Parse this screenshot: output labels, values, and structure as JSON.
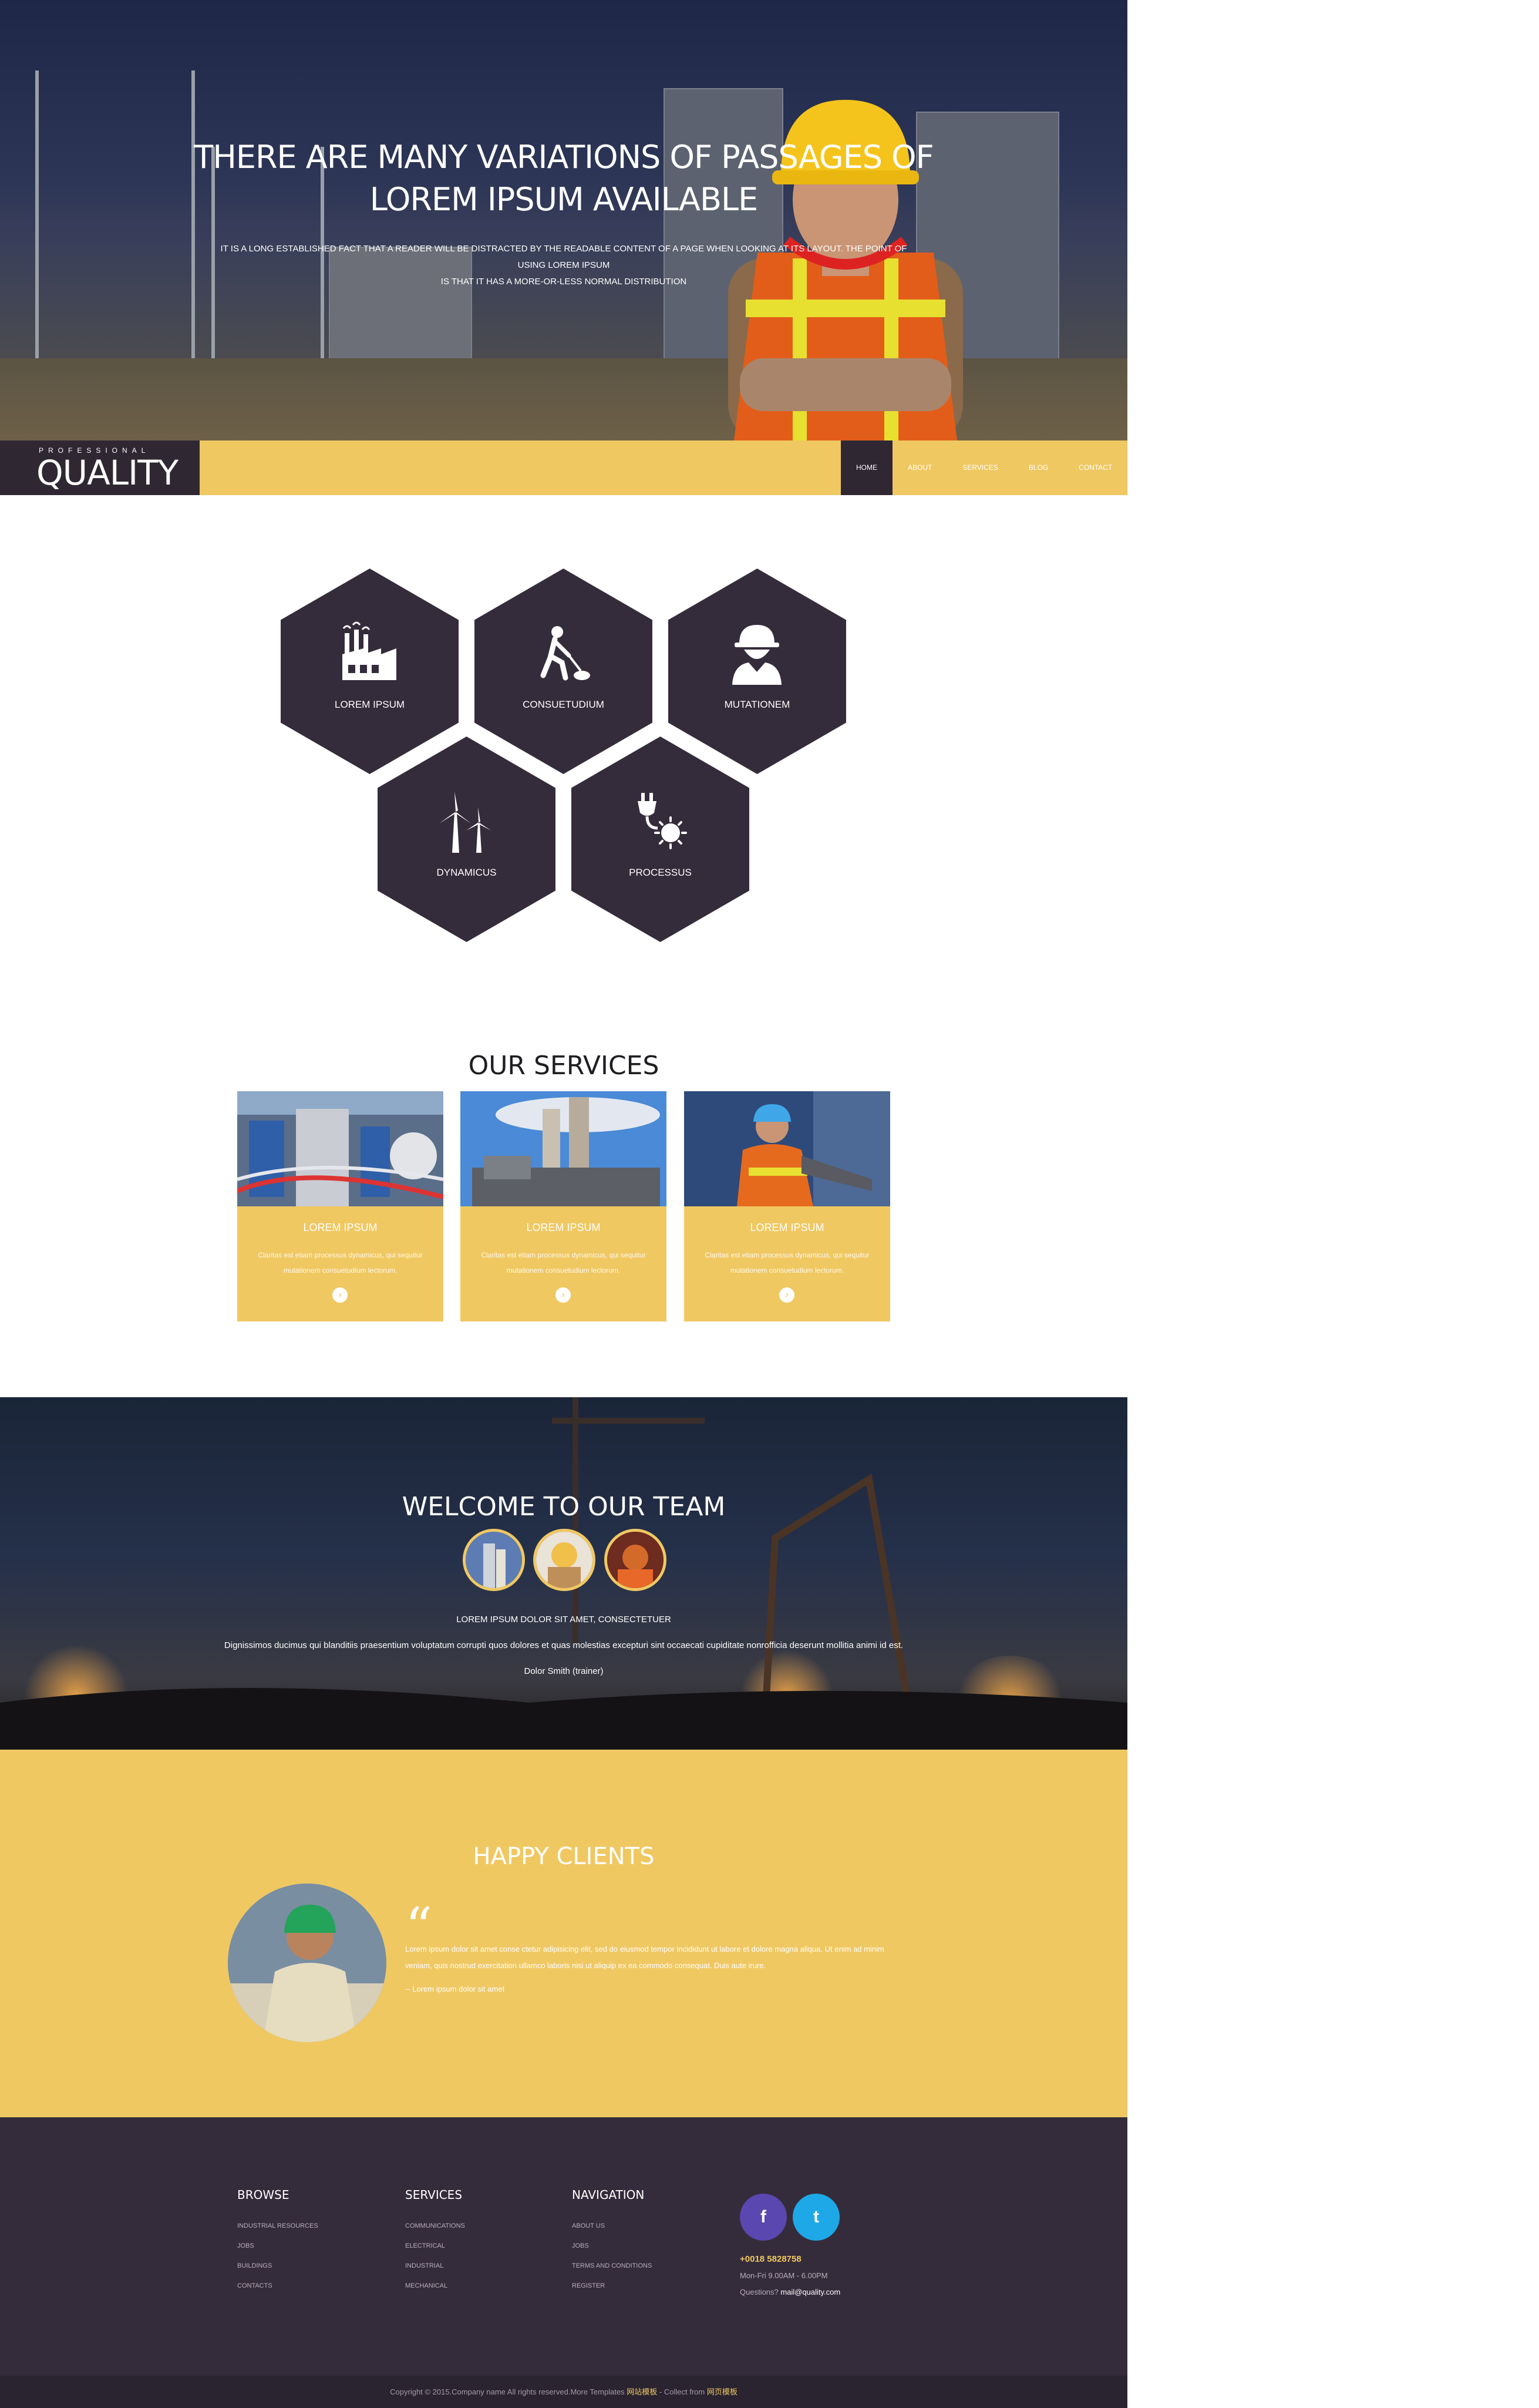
{
  "hero": {
    "title_line1": "THERE ARE MANY VARIATIONS OF PASSAGES OF",
    "title_line2": "LOREM IPSUM AVAILABLE",
    "subtitle_line1": "IT IS A LONG ESTABLISHED FACT THAT A READER WILL BE DISTRACTED BY THE READABLE CONTENT OF A PAGE WHEN LOOKING AT ITS LAYOUT. THE POINT OF USING LOREM IPSUM",
    "subtitle_line2": "IS THAT IT HAS A MORE-OR-LESS NORMAL DISTRIBUTION"
  },
  "logo": {
    "small": "PROFESSIONAL",
    "big": "QUALITY"
  },
  "nav": {
    "items": [
      "HOME",
      "ABOUT",
      "SERVICES",
      "BLOG",
      "CONTACT"
    ],
    "active": "HOME"
  },
  "features": [
    {
      "label": "LOREM IPSUM",
      "icon": "factory-icon"
    },
    {
      "label": "CONSUETUDIUM",
      "icon": "digging-worker-icon"
    },
    {
      "label": "MUTATIONEM",
      "icon": "worker-helmet-icon"
    },
    {
      "label": "DYNAMICUS",
      "icon": "wind-turbine-icon"
    },
    {
      "label": "PROCESSUS",
      "icon": "plug-sun-icon"
    }
  ],
  "services": {
    "title": "OUR SERVICES",
    "cards": [
      {
        "title": "LOREM IPSUM",
        "text": "Claritas est etiam processus dynamicus, qui sequitur mutationem consuetudium lectorum."
      },
      {
        "title": "LOREM IPSUM",
        "text": "Claritas est etiam processus dynamicus, qui sequitur mutationem consuetudium lectorum."
      },
      {
        "title": "LOREM IPSUM",
        "text": "Claritas est etiam processus dynamicus, qui sequitur mutationem consuetudium lectorum."
      }
    ]
  },
  "team": {
    "title": "WELCOME TO OUR TEAM",
    "heading": "LOREM IPSUM DOLOR SIT AMET, CONSECTETUER",
    "text": "Dignissimos ducimus qui blanditiis praesentium voluptatum corrupti quos dolores et quas molestias excepturi sint occaecati cupiditate nonrofficia deserunt mollitia animi id est.",
    "author": "Dolor Smith (trainer)"
  },
  "clients": {
    "title": "HAPPY CLIENTS",
    "quote": "Lorem ipsum dolor sit amet conse ctetur adipisicing elit, sed do eiusmod tempor incididunt ut labore et dolore magna aliqua. Ut enim ad minim veniam, quis nostrud exercitation ullamco laboris nisi ut aliquip ex ea commodo consequat. Duis aute irure.",
    "author": "-- Lorem ipsum dolor sit amet"
  },
  "footer": {
    "browse": {
      "title": "BROWSE",
      "items": [
        "INDUSTRIAL RESOURCES",
        "JOBS",
        "BUILDINGS",
        "CONTACTS"
      ]
    },
    "services": {
      "title": "SERVICES",
      "items": [
        "COMMUNICATIONS",
        "ELECTRICAL",
        "INDUSTRIAL",
        "MECHANICAL"
      ]
    },
    "navigation": {
      "title": "NAVIGATION",
      "items": [
        "ABOUT US",
        "JOBS",
        "TERMS AND CONDITIONS",
        "REGISTER"
      ]
    },
    "phone": "+0018 5828758",
    "hours": "Mon-Fri 9.00AM - 6.00PM",
    "email_label": "Questions?",
    "email": "mail@quality.com",
    "copyright": "Copyright © 2015.Company name All rights reserved.More Templates ",
    "copyright_link1": "网站模板",
    "copyright_mid": " - Collect from ",
    "copyright_link2": "网页模板"
  },
  "colors": {
    "accent": "#f0c862",
    "dark": "#352c3b",
    "facebook": "#5a47b0",
    "twitter": "#1ea8e8"
  }
}
